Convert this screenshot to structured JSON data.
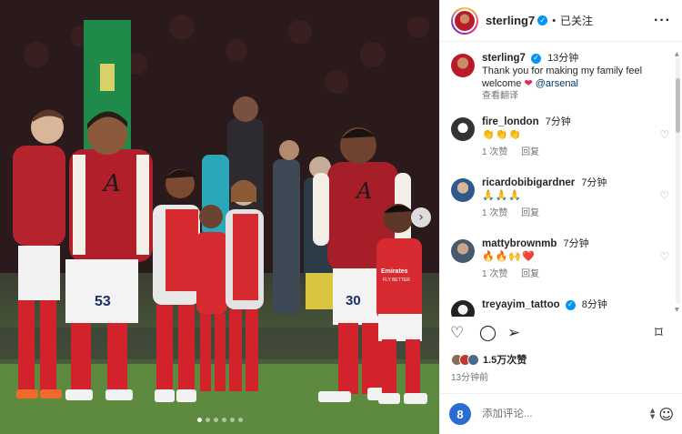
{
  "header": {
    "username": "sterling7",
    "separator": "•",
    "follow_status": "已关注",
    "more_label": "···"
  },
  "caption": {
    "username": "sterling7",
    "time": "13分钟",
    "text": "Thank you for making my family feel welcome",
    "heart": "❤",
    "mention": "@arsenal",
    "translate": "查看翻译"
  },
  "comments": [
    {
      "username": "fire_london",
      "time": "7分钟",
      "text": "👏👏👏",
      "likes": "1 次赞",
      "reply": "回复",
      "verified": false
    },
    {
      "username": "ricardobibigardner",
      "time": "7分钟",
      "text": "🙏🙏🙏",
      "likes": "1 次赞",
      "reply": "回复",
      "verified": false
    },
    {
      "username": "mattybrownmb",
      "time": "7分钟",
      "text": "🔥🔥🙌❤️",
      "likes": "1 次赞",
      "reply": "回复",
      "verified": false
    },
    {
      "username": "treyayim_tattoo",
      "time": "8分钟",
      "text": "",
      "likes": "",
      "reply": "",
      "verified": true
    }
  ],
  "actions": {
    "like_icon": "heart-outline",
    "comment_icon": "comment-bubble",
    "share_icon": "paper-plane",
    "save_icon": "bookmark"
  },
  "likes_count": "1.5万次赞",
  "posted_ago": "13分钟前",
  "composer": {
    "placeholder": "添加评论...",
    "app_icon_glyph": "8"
  },
  "photo": {
    "shirt_numbers": [
      "53",
      "30"
    ],
    "sponsor_text": "Emirates FLY BETTER",
    "carousel_dots": 6,
    "active_dot": 0
  },
  "colors": {
    "verified": "#0095f6",
    "link": "#00376b",
    "secondary_text": "#737373",
    "arsenal_red": "#db1f2b"
  }
}
